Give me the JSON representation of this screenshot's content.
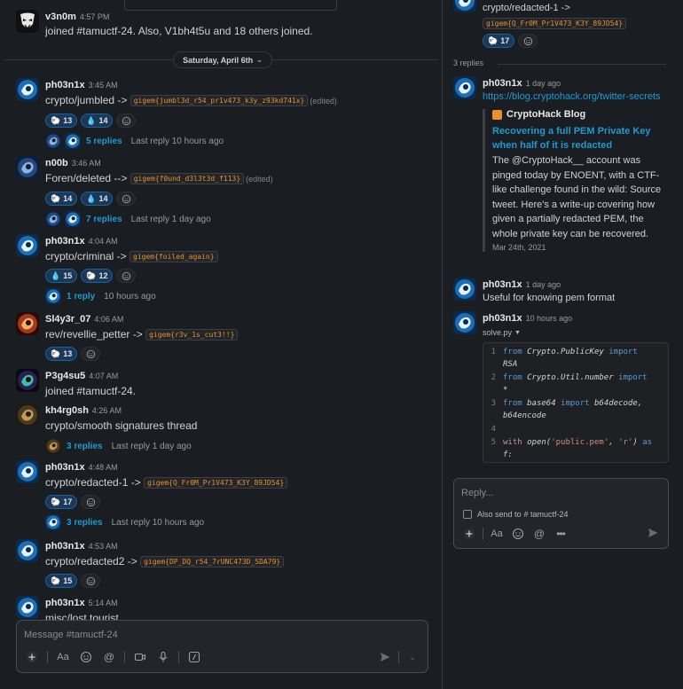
{
  "channel": "#tamuctf-24",
  "top_message": {
    "user": "v3n0m",
    "time": "4:57 PM",
    "text": "joined #tamuctf-24. Also, V1bh4t5u and 18 others joined."
  },
  "day_divider": "Saturday, April 6th",
  "messages": [
    {
      "user": "ph03n1x",
      "time": "3:45 AM",
      "text": "crypto/jumbled ->",
      "flag": "gigem{jumbl3d_r54_pr1v473_k3y_z93kd741x}",
      "edited": "(edited)",
      "reactions": [
        {
          "emoji": "sheep",
          "count": "13"
        },
        {
          "emoji": "drop-of-blood",
          "count": "14"
        }
      ],
      "thread": {
        "replies": "5 replies",
        "last": "Last reply 10 hours ago"
      }
    },
    {
      "user": "n00b",
      "time": "3:46 AM",
      "text": "Foren/deleted -->",
      "flag": "gigem{f0und_d3l3t3d_f113}",
      "edited": "(edited)",
      "reactions": [
        {
          "emoji": "sheep",
          "count": "14"
        },
        {
          "emoji": "drop-of-blood",
          "count": "14"
        }
      ],
      "thread": {
        "replies": "7 replies",
        "last": "Last reply 1 day ago"
      }
    },
    {
      "user": "ph03n1x",
      "time": "4:04 AM",
      "text": "crypto/criminal ->",
      "flag": "gigem{foiled_again}",
      "reactions": [
        {
          "emoji": "drop-of-blood",
          "count": "15"
        },
        {
          "emoji": "sheep",
          "count": "12"
        }
      ],
      "thread": {
        "replies": "1 reply",
        "last": "10 hours ago"
      }
    },
    {
      "user": "Sl4y3r_07",
      "time": "4:06 AM",
      "text": "rev/revellie_petter ->",
      "flag": "gigem{r3v_1s_cut3!!}",
      "reactions": [
        {
          "emoji": "sheep",
          "count": "13"
        }
      ]
    },
    {
      "user": "P3g4su5",
      "time": "4:07 AM",
      "text": "joined #tamuctf-24."
    },
    {
      "user": "kh4rg0sh",
      "time": "4:26 AM",
      "text": "crypto/smooth signatures thread",
      "thread": {
        "replies": "3 replies",
        "last": "Last reply 1 day ago"
      }
    },
    {
      "user": "ph03n1x",
      "time": "4:48 AM",
      "text": "crypto/redacted-1 ->",
      "flag": "gigem{Q_Fr0M_Pr1V473_K3Y_89JD54}",
      "reactions": [
        {
          "emoji": "sheep",
          "count": "17"
        }
      ],
      "thread": {
        "replies": "3 replies",
        "last": "Last reply 10 hours ago"
      }
    },
    {
      "user": "ph03n1x",
      "time": "4:53 AM",
      "text": "crypto/redacted2 ->",
      "flag": "gigem{DP_DQ_r54_7rUNC473D_SDA79}",
      "reactions": [
        {
          "emoji": "sheep",
          "count": "15"
        }
      ]
    },
    {
      "user": "ph03n1x",
      "time": "5:14 AM",
      "text": "misc/lost tourist"
    }
  ],
  "composer": {
    "placeholder": "Message #tamuctf-24"
  },
  "thread_panel": {
    "parent": {
      "text": "crypto/redacted-1 ->",
      "flag": "gigem{Q_Fr0M_Pr1V473_K3Y_89JD54}",
      "reaction_count": "17"
    },
    "replies_header": "3 replies",
    "replies": [
      {
        "user": "ph03n1x",
        "time": "1 day ago",
        "link": "https://blog.cryptohack.org/twitter-secrets",
        "unfurl": {
          "site": "CryptoHack Blog",
          "title": "Recovering a full PEM Private Key when half of it is redacted",
          "description": "The @CryptoHack__ account was pinged today by ENOENT, with a CTF-like challenge found in the wild: Source tweet. Here's a write-up covering how given a partially redacted PEM, the whole private key can be recovered.",
          "date": "Mar 24th, 2021"
        }
      },
      {
        "user": "ph03n1x",
        "time": "1 day ago",
        "text": "Useful for knowing pem format"
      },
      {
        "user": "ph03n1x",
        "time": "10 hours ago",
        "file": "solve.py"
      }
    ],
    "code_lines": [
      {
        "n": "1",
        "parts": [
          [
            "kw2",
            "from"
          ],
          [
            "mod",
            " Crypto.PublicKey "
          ],
          [
            "kw2",
            "import"
          ]
        ],
        "cont": "RSA"
      },
      {
        "n": "2",
        "parts": [
          [
            "kw2",
            "from"
          ],
          [
            "mod",
            " Crypto.Util.number "
          ],
          [
            "kw2",
            "import"
          ]
        ],
        "cont": "*"
      },
      {
        "n": "3",
        "parts": [
          [
            "kw2",
            "from"
          ],
          [
            "mod",
            " base64 "
          ],
          [
            "kw2",
            "import"
          ],
          [
            "mod",
            " b64decode,"
          ]
        ],
        "cont": "b64encode"
      },
      {
        "n": "4",
        "parts": [],
        "cont": ""
      },
      {
        "n": "5",
        "parts": [
          [
            "kw",
            "with"
          ],
          [
            "mod",
            " open("
          ],
          [
            "str",
            "'public.pem'"
          ],
          [
            "mod",
            ", "
          ],
          [
            "str",
            "'r'"
          ],
          [
            "mod",
            ") "
          ],
          [
            "kw2",
            "as"
          ]
        ],
        "cont": "f:"
      }
    ],
    "composer": {
      "placeholder": "Reply...",
      "also_send_prefix": "Also send to",
      "also_send_channel": "# tamuctf-24"
    }
  }
}
